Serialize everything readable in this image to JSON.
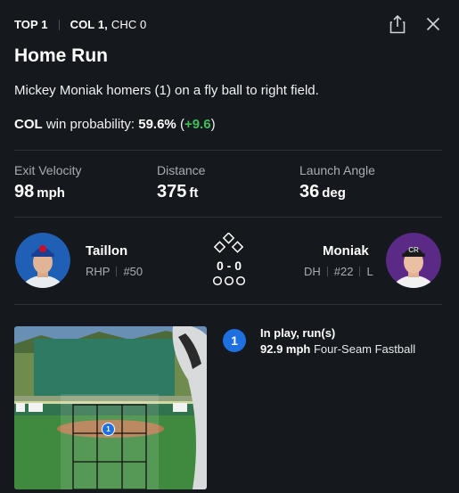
{
  "inning": "TOP 1",
  "score_line": {
    "team1": "COL 1,",
    "team2": "CHC 0"
  },
  "event": {
    "title": "Home Run",
    "description": "Mickey Moniak homers (1) on a fly ball to right field.",
    "win_prob_team": "COL",
    "win_prob_label": "win probability:",
    "win_prob_value": "59.6%",
    "win_prob_delta": "+9.6"
  },
  "stats": [
    {
      "label": "Exit Velocity",
      "value": "98",
      "unit": "mph"
    },
    {
      "label": "Distance",
      "value": "375",
      "unit": "ft"
    },
    {
      "label": "Launch Angle",
      "value": "36",
      "unit": "deg"
    }
  ],
  "pitcher": {
    "name": "Taillon",
    "position": "RHP",
    "number": "#50"
  },
  "batter": {
    "name": "Moniak",
    "position": "DH",
    "number": "#22",
    "hand": "L"
  },
  "count": "0 - 0",
  "pitch": {
    "index": "1",
    "result": "In play, run(s)",
    "speed": "92.9 mph",
    "type": "Four-Seam Fastball"
  },
  "icons": {
    "share": "share-icon",
    "close": "close-icon",
    "bases": "bases-icon",
    "outs": "outs-icon"
  },
  "colors": {
    "background": "#15181d",
    "positive": "#3fbf5a",
    "accent": "#1e6fe0",
    "cubs": "#1f5fb5",
    "rockies": "#5b2a86"
  }
}
